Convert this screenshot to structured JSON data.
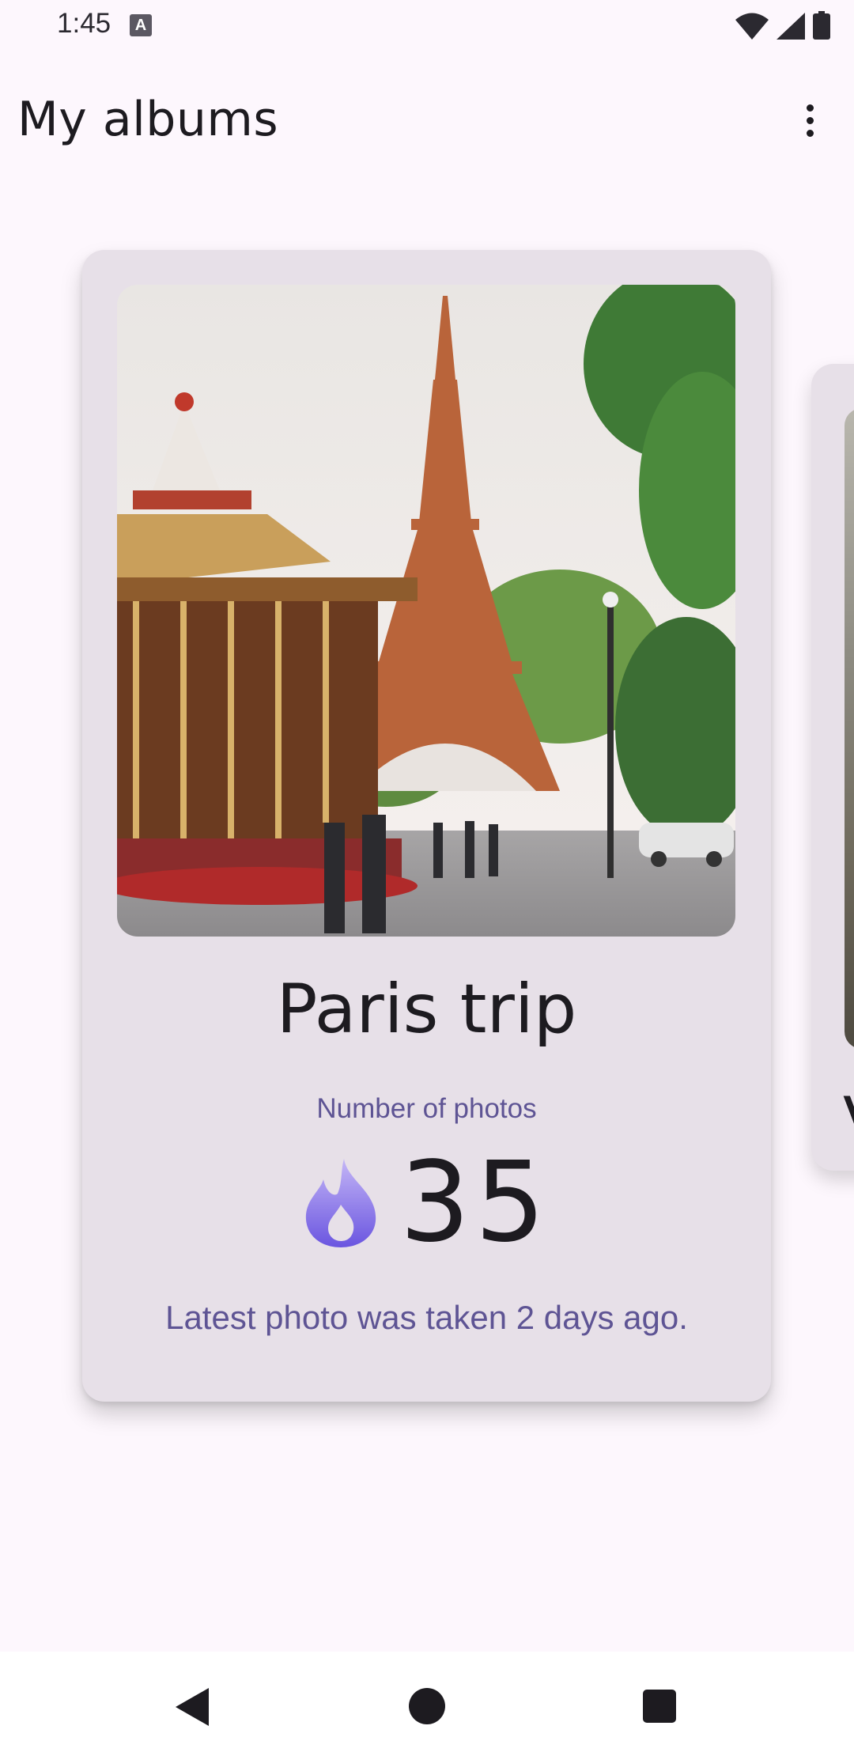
{
  "status_bar": {
    "time": "1:45",
    "notification_icon": "A",
    "icons": [
      "wifi-icon",
      "signal-icon",
      "battery-icon"
    ]
  },
  "app_bar": {
    "title": "My albums",
    "menu_icon": "more-vert-icon"
  },
  "album": {
    "title": "Paris trip",
    "count_label": "Number of photos",
    "count": "35",
    "count_icon": "flame-icon",
    "latest_photo_text": "Latest photo was taken 2 days ago.",
    "cover_description_icon": "eiffel-tower-photo"
  },
  "next_album": {
    "title_initial": "V"
  },
  "nav_bar": {
    "icons": [
      "back-icon",
      "home-icon",
      "recents-icon"
    ]
  },
  "colors": {
    "background": "#fdf7fd",
    "card": "#e7e0e8",
    "accent_text": "#5e5494",
    "flame_gradient_top": "#b6a6f2",
    "flame_gradient_bottom": "#6c5ce7"
  }
}
